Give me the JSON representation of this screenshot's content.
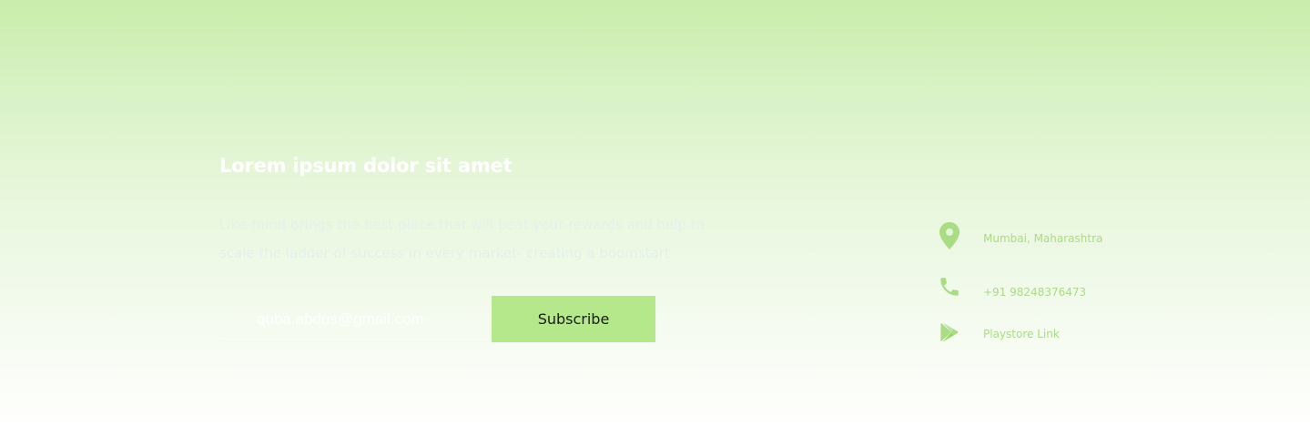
{
  "newsletter": {
    "title": "Lorem ipsum dolor sit amet",
    "description": "Like-mind brings the best place that will beat your rewards and help to scale the ladder of success in every market- creating a boomstart",
    "email_value": "quba.abdus@gmail.com",
    "subscribe_label": "Subscribe"
  },
  "contact": {
    "location": {
      "icon": "map-pin-icon",
      "label": "Mumbai, Maharashtra"
    },
    "phone": {
      "icon": "phone-icon",
      "label": "+91 98248376473"
    },
    "playstore": {
      "icon": "play-store-icon",
      "label": "Playstore Link"
    }
  },
  "colors": {
    "accent": "#b4e88a",
    "icon": "#a9dc84",
    "bg_top": "#c9edab",
    "bg_bottom": "#ffffff"
  }
}
